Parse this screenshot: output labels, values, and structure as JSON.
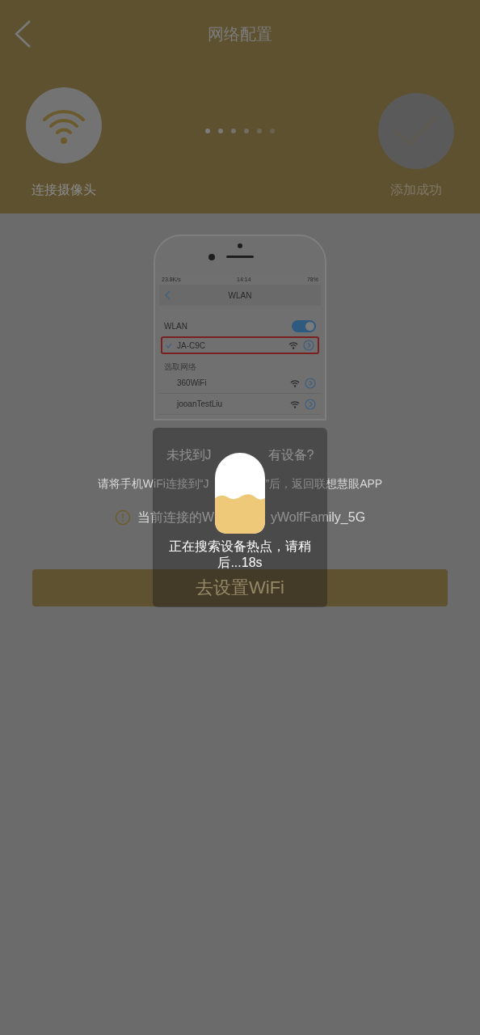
{
  "header": {
    "title": "网络配置"
  },
  "steps": [
    {
      "kind": "wifi",
      "label": "连接摄像头",
      "done": true
    },
    {
      "kind": "check",
      "label": "添加成功",
      "done": false
    }
  ],
  "phone_screen": {
    "status_bar": {
      "speed": "23.8K/s",
      "time": "14:14",
      "battery": "78%"
    },
    "nav_title": "WLAN",
    "wlan_label": "WLAN",
    "wlan_on": true,
    "connected": {
      "name": "JA-C9C",
      "selected": true
    },
    "section": "选取网络",
    "networks": [
      {
        "name": "360WiFi"
      },
      {
        "name": "jooanTestLiu"
      }
    ]
  },
  "hint": {
    "title_parts": [
      "未找到J",
      "有设备?"
    ],
    "instruction_parts": [
      "请将手机WiFi连接到“J",
      "”后，返回联想慧眼APP"
    ],
    "current_parts": [
      "当前连接的W",
      "yWolfFamily_5G"
    ]
  },
  "button": "去设置WiFi",
  "toast": {
    "message": "正在搜索设备热点，请稍后...18s"
  }
}
